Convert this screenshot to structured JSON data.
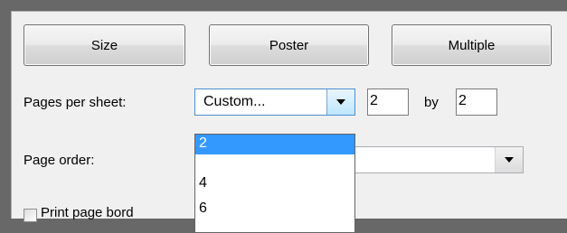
{
  "buttons": {
    "size": "Size",
    "poster": "Poster",
    "multiple": "Multiple"
  },
  "pages_per_sheet": {
    "label": "Pages per sheet:",
    "selected": "Custom...",
    "cols": "2",
    "by": "by",
    "rows": "2",
    "options": [
      "2",
      "4",
      "6"
    ],
    "highlighted_option": "2"
  },
  "page_order": {
    "label": "Page order:"
  },
  "print_page_border": {
    "label": "Print page bord",
    "checked": false
  },
  "colors": {
    "highlight": "#3399ff",
    "focus_border": "#4d8fd1"
  }
}
